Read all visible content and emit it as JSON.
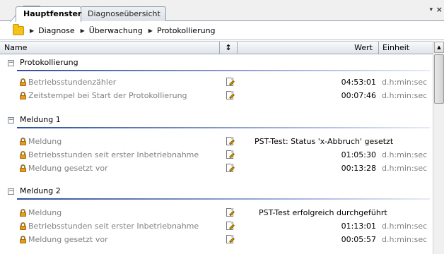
{
  "tabs": [
    {
      "label": "Hauptfenster",
      "active": true
    },
    {
      "label": "Diagnoseübersicht",
      "active": false
    }
  ],
  "window_controls": {
    "menu_arrow": "▾",
    "close": "×"
  },
  "breadcrumb": {
    "icon": "folder-icon",
    "items": [
      "Diagnose",
      "Überwachung",
      "Protokollierung"
    ]
  },
  "grid_header": {
    "name": "Name",
    "sort_icon": "↕",
    "value": "Wert",
    "unit": "Einheit"
  },
  "groups": [
    {
      "title": "Protokollierung",
      "rows": [
        {
          "name": "Betriebsstundenzähler",
          "value": "04:53:01",
          "unit": "d.h:min:sec"
        },
        {
          "name": "Zeitstempel bei Start der Protokollierung",
          "value": "00:07:46",
          "unit": "d.h:min:sec"
        }
      ]
    },
    {
      "title": "Meldung 1",
      "rows": [
        {
          "name": "Meldung",
          "value": "PST-Test: Status 'x-Abbruch' gesetzt",
          "unit": ""
        },
        {
          "name": "Betriebsstunden seit erster Inbetriebnahme",
          "value": "01:05:30",
          "unit": "d.h:min:sec"
        },
        {
          "name": "Meldung gesetzt vor",
          "value": "00:13:28",
          "unit": "d.h:min:sec"
        }
      ]
    },
    {
      "title": "Meldung 2",
      "rows": [
        {
          "name": "Meldung",
          "value": "PST-Test erfolgreich durchgeführt",
          "unit": ""
        },
        {
          "name": "Betriebsstunden seit erster Inbetriebnahme",
          "value": "01:13:01",
          "unit": "d.h:min:sec"
        },
        {
          "name": "Meldung gesetzt vor",
          "value": "00:05:57",
          "unit": "d.h:min:sec"
        }
      ]
    }
  ],
  "colors": {
    "group_line": "#2f4c9c",
    "lock": "#e79a1c",
    "folder": "#f5c21b",
    "muted_text": "#808080"
  }
}
